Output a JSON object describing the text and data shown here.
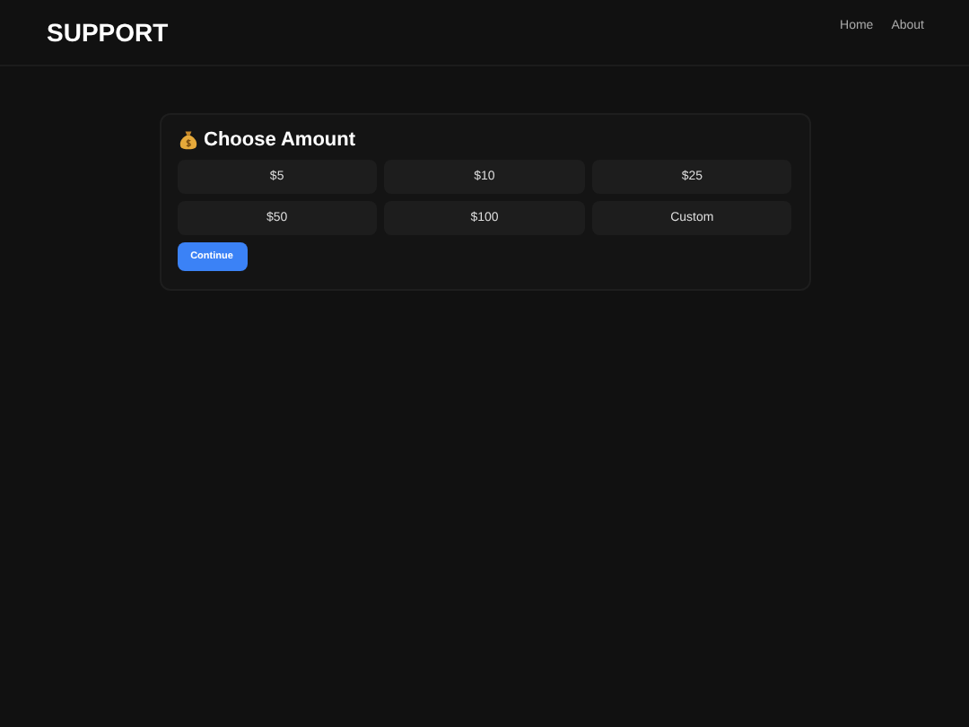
{
  "header": {
    "logo": "SUPPORT",
    "nav": [
      "Home",
      "About"
    ]
  },
  "card": {
    "title": "Choose Amount",
    "amounts": [
      "$5",
      "$10",
      "$25",
      "$50",
      "$100",
      "Custom"
    ],
    "continue": "Continue"
  }
}
